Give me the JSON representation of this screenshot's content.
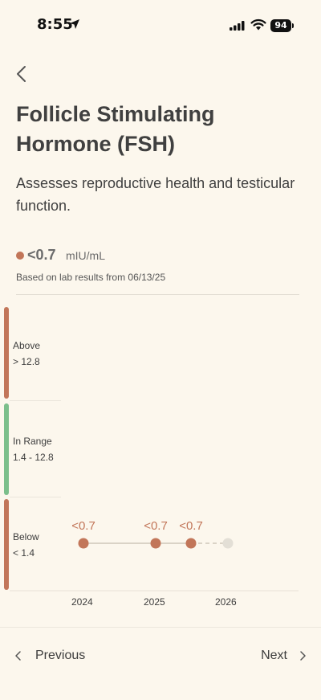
{
  "status": {
    "time": "8:55",
    "battery": "94"
  },
  "header": {
    "title": "Follicle Stimulating Hormone (FSH)",
    "subtitle": "Assesses reproductive health and testicular function."
  },
  "result": {
    "value": "<0.7",
    "unit": "mIU/mL",
    "based_on": "Based on lab results from 06/13/25",
    "status_color": "#c27659"
  },
  "ranges": [
    {
      "name": "Above",
      "range": "> 12.8",
      "color": "#c27659"
    },
    {
      "name": "In Range",
      "range": "1.4 - 12.8",
      "color": "#7cbf8b"
    },
    {
      "name": "Below",
      "range": " < 1.4",
      "color": "#c27659"
    }
  ],
  "chart_data": {
    "type": "line",
    "x": [
      "2024",
      "2025",
      "2025"
    ],
    "values": [
      0.7,
      0.7,
      0.7
    ],
    "value_labels": [
      "<0.7",
      "<0.7",
      "<0.7"
    ],
    "x_ticks": [
      "2024",
      "2025",
      "2026"
    ],
    "point_color": "#c27659",
    "projected_point_color": "#e3dfd6"
  },
  "nav": {
    "previous": "Previous",
    "next": "Next"
  }
}
